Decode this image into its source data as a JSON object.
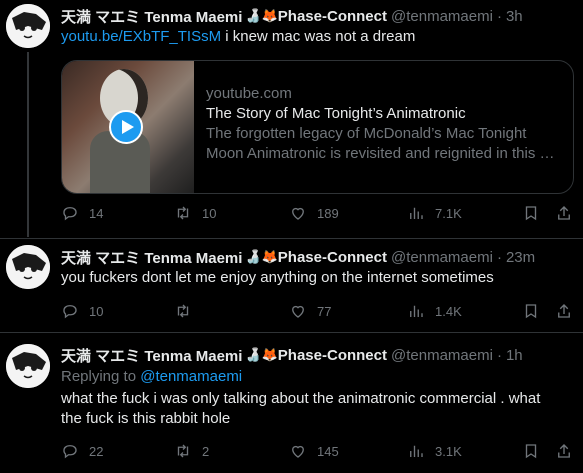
{
  "tweets": [
    {
      "display_name": "天満 マエミ Tenma Maemi",
      "emoji": "🍶🦊",
      "org": "Phase-Connect",
      "handle": "@tenmamaemi",
      "time": "3h",
      "link": "youtu.be/EXbTF_TISsM",
      "text": " i knew mac was not a dream",
      "card": {
        "domain": "youtube.com",
        "title": "The Story of Mac Tonight’s Animatronic",
        "desc_line1": "The forgotten legacy of McDonald’s Mac Tonight",
        "desc_line2": "Moon Animatronic is revisited and reignited in this …"
      },
      "replies": "14",
      "retweets": "10",
      "likes": "189",
      "views": "7.1K"
    },
    {
      "display_name": "天満 マエミ Tenma Maemi",
      "emoji": "🍶🦊",
      "org": "Phase-Connect",
      "handle": "@tenmamaemi",
      "time": "23m",
      "text": "you fuckers dont let me enjoy anything on the internet sometimes",
      "replies": "10",
      "retweets": "",
      "likes": "77",
      "views": "1.4K"
    },
    {
      "display_name": "天満 マエミ Tenma Maemi",
      "emoji": "🍶🦊",
      "org": "Phase-Connect",
      "handle": "@tenmamaemi",
      "time": "1h",
      "replying_prefix": "Replying to ",
      "replying_to": "@tenmamaemi",
      "text_line1": "what the fuck i was only talking about the animatronic commercial . what",
      "text_line2": "the fuck is this rabbit hole",
      "replies": "22",
      "retweets": "2",
      "likes": "145",
      "views": "3.1K"
    }
  ],
  "icons": {
    "reply": "reply-icon",
    "retweet": "retweet-icon",
    "like": "heart-icon",
    "views": "views-icon",
    "bookmark": "bookmark-icon",
    "share": "share-icon"
  },
  "colors": {
    "accent": "#1d9bf0",
    "muted": "#71767b",
    "text": "#e7e9ea",
    "bg": "#000000"
  }
}
